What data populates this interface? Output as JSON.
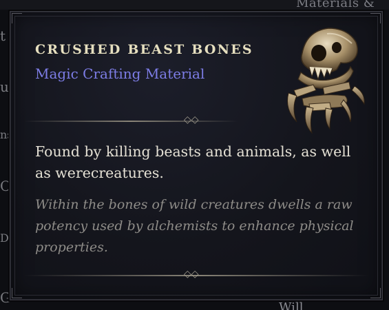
{
  "background": {
    "top_text": "Materials &",
    "bottom_text": "Will",
    "left_fragments": [
      "t",
      "u",
      "ns",
      "O",
      "Da",
      "G"
    ]
  },
  "tooltip": {
    "item_name": "CRUSHED BEAST BONES",
    "item_type": "Magic Crafting Material",
    "description": "Found by killing beasts and animals, as well as werecreatures.",
    "flavor_text": "Within the bones of wild creatures dwells a raw potency used by alchemists to enhance physical properties.",
    "icon": "beast-skull-bones-icon",
    "ornament": "◇◇"
  },
  "colors": {
    "item_name": "#e6dfbf",
    "item_type_magic": "#7d7de6",
    "description": "#e4e0d4",
    "flavor": "#8e8c88",
    "panel_bg": "#14151c"
  }
}
